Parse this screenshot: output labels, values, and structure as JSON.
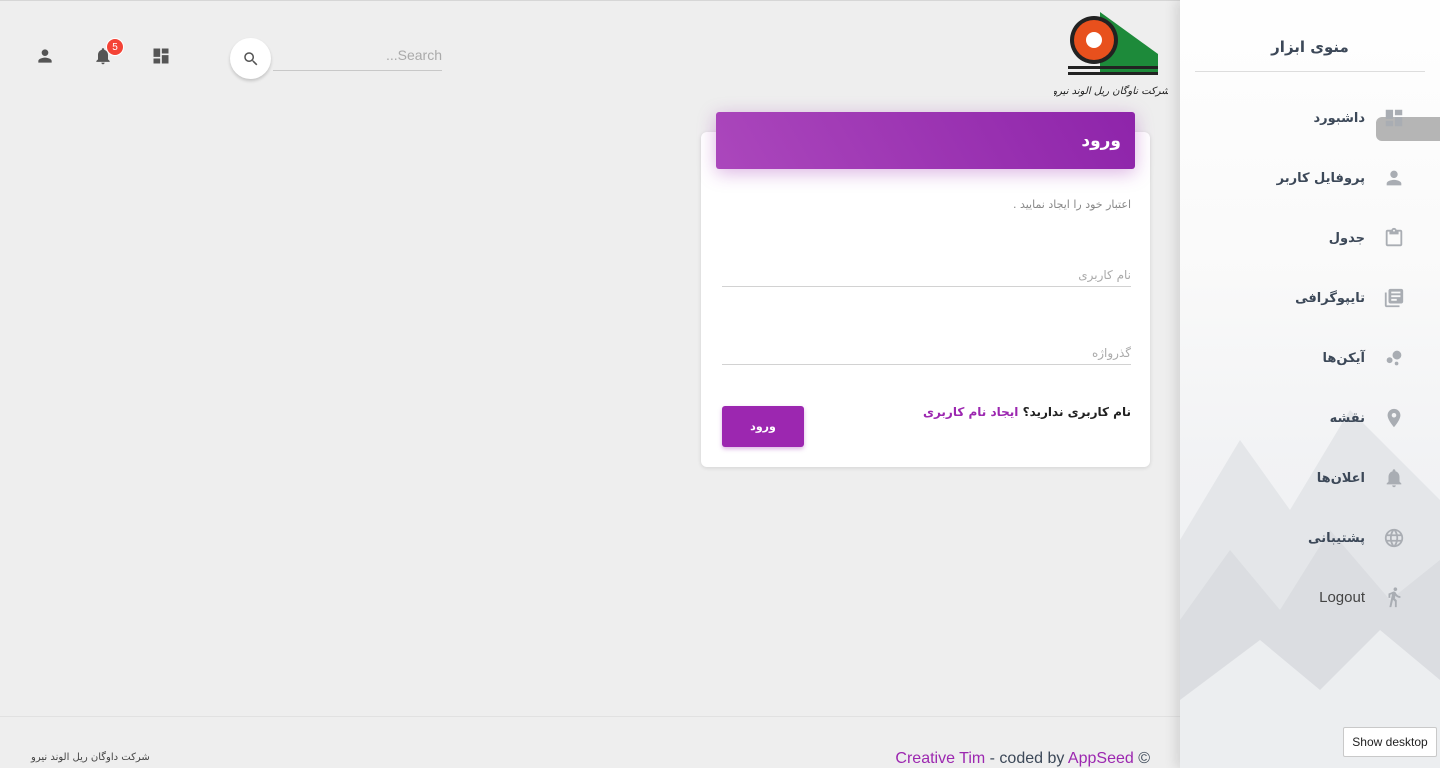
{
  "navbar": {
    "search_placeholder": "...Search",
    "notification_count": "5",
    "icons": [
      "person-icon",
      "notifications-icon",
      "dashboard-icon",
      "search-icon"
    ]
  },
  "logo": {
    "company_text": "شرکت ناوگان ریل الوند نیرو",
    "colors": {
      "orange": "#e8501d",
      "green": "#1d8a3a",
      "dark": "#222222"
    }
  },
  "login": {
    "title": "ورود",
    "subtitle": "اعتبار خود را ایجاد نمایید .",
    "username_placeholder": "نام کاربری",
    "password_placeholder": "گذرواژه",
    "no_account_text": "نام کاربری ندارید؟",
    "signup_link": "ایجاد نام کاربری",
    "submit_label": "ورود",
    "accent": "#9c27b0"
  },
  "sidebar": {
    "title": "منوی ابزار",
    "items": [
      {
        "label": "داشبورد",
        "icon": "dashboard-icon",
        "active": true
      },
      {
        "label": "پروفایل کاربر",
        "icon": "person-icon"
      },
      {
        "label": "جدول",
        "icon": "clipboard-icon"
      },
      {
        "label": "تایپوگرافی",
        "icon": "library-books-icon"
      },
      {
        "label": "آیکن‌ها",
        "icon": "bubble-chart-icon"
      },
      {
        "label": "نقشه",
        "icon": "location-icon"
      },
      {
        "label": "اعلان‌ها",
        "icon": "notifications-icon"
      },
      {
        "label": "پشتیبانی",
        "icon": "language-icon"
      },
      {
        "label": "Logout",
        "icon": "run-icon"
      }
    ]
  },
  "footer": {
    "company": "شرکت داوگان ریل الوند نیرو",
    "credit_prefix": "Creative Tim",
    "credit_middle": " - coded by ",
    "credit_link": "AppSeed",
    "credit_suffix": " ©"
  },
  "taskbar": {
    "show_desktop": "Show desktop"
  }
}
